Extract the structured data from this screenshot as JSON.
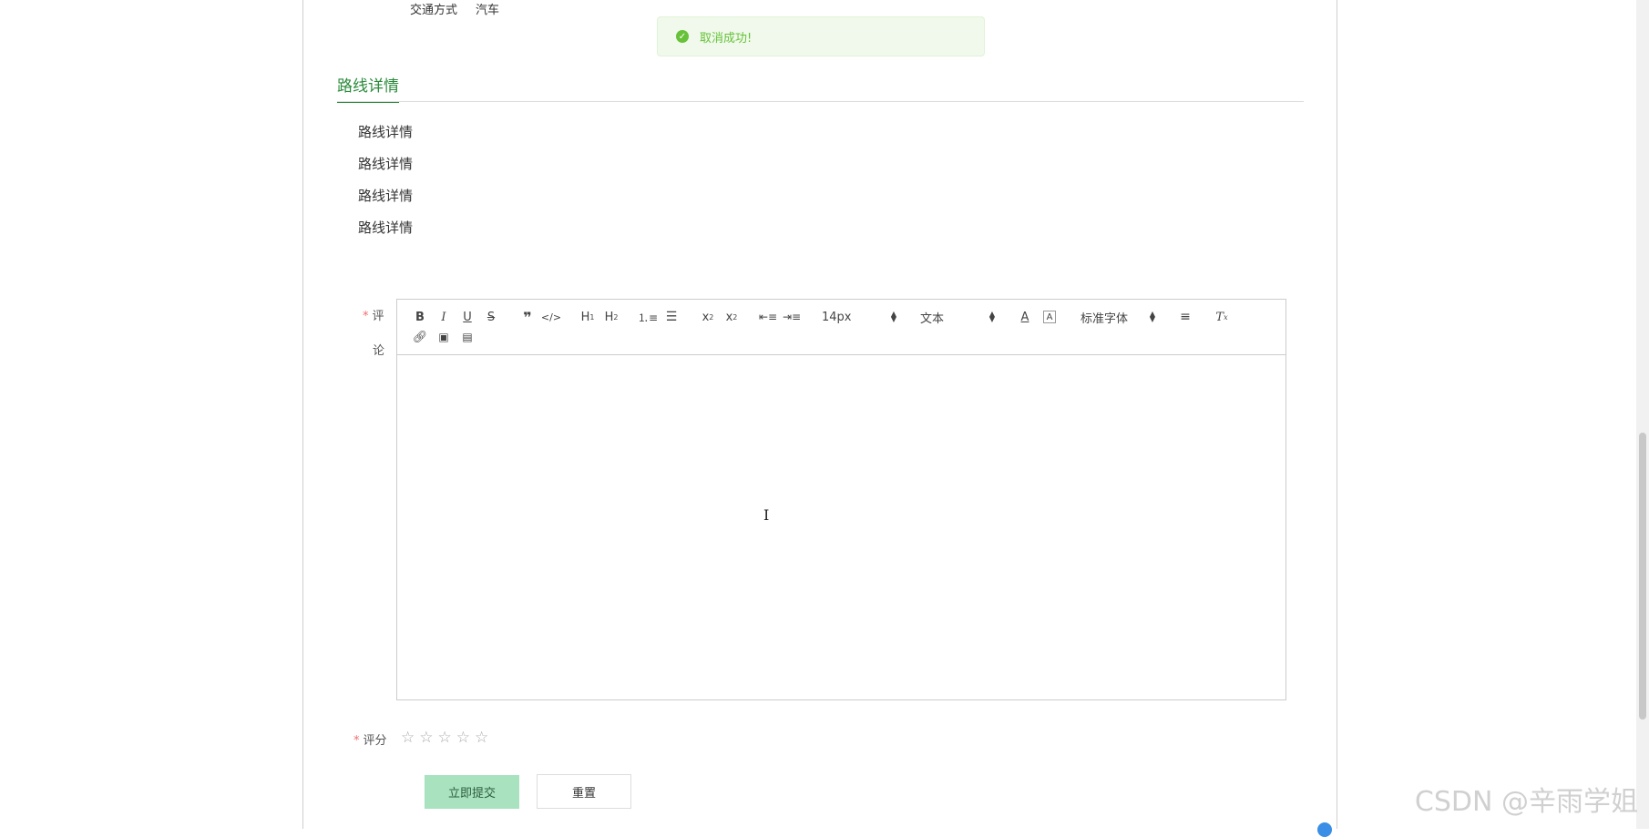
{
  "info": {
    "label": "交通方式",
    "value": "汽车"
  },
  "toast": {
    "message": "取消成功!"
  },
  "section": {
    "title": "路线详情"
  },
  "route_items": [
    "路线详情",
    "路线详情",
    "路线详情",
    "路线详情"
  ],
  "comment": {
    "required_mark": "*",
    "label_line1": "评",
    "label_line2": "论"
  },
  "toolbar": {
    "font_size": "14px",
    "heading": "文本",
    "font_family": "标准字体"
  },
  "rating": {
    "required_mark": "*",
    "label": "评分",
    "max": 5,
    "value": 0
  },
  "buttons": {
    "submit": "立即提交",
    "reset": "重置"
  },
  "watermark": "CSDN @辛雨学姐",
  "colors": {
    "accent": "#2a8a3a",
    "success": "#67c23a",
    "submit_bg": "#a8e2bf"
  }
}
